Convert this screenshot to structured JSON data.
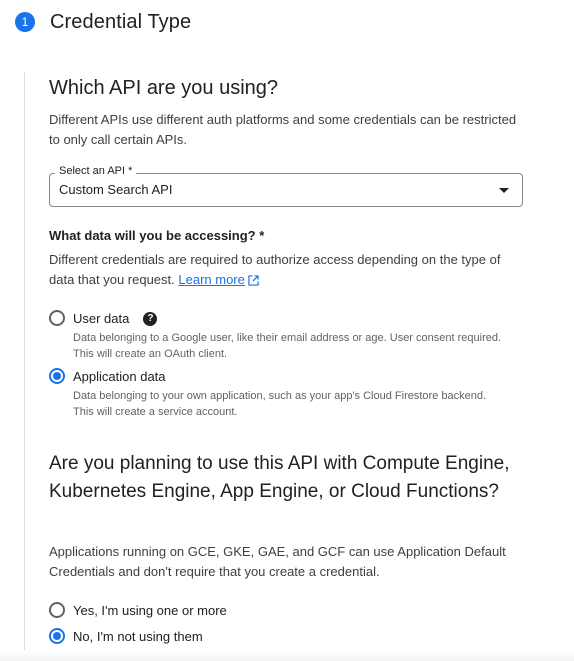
{
  "step": {
    "number": "1",
    "title": "Credential Type"
  },
  "api_question": {
    "title": "Which API are you using?",
    "description": "Different APIs use different auth platforms and some credentials can be restricted to only call certain APIs.",
    "select": {
      "label": "Select an API *",
      "value": "Custom Search API"
    }
  },
  "data_question": {
    "title": "What data will you be accessing? *",
    "description": "Different credentials are required to authorize access depending on the type of data that you request.",
    "learn_more": "Learn more",
    "options": [
      {
        "label": "User data",
        "help": "Data belonging to a Google user, like their email address or age. User consent required. This will create an OAuth client.",
        "selected": false
      },
      {
        "label": "Application data",
        "help": "Data belonging to your own application, such as your app's Cloud Firestore backend. This will create a service account.",
        "selected": true
      }
    ]
  },
  "compute_question": {
    "title": "Are you planning to use this API with Compute Engine, Kubernetes Engine, App Engine, or Cloud Functions?",
    "description": "Applications running on GCE, GKE, GAE, and GCF can use Application Default Credentials and don't require that you create a credential.",
    "options": [
      {
        "label": "Yes, I'm using one or more",
        "selected": false
      },
      {
        "label": "No, I'm not using them",
        "selected": true
      }
    ]
  },
  "colors": {
    "accent": "#1a73e8",
    "text": "#202124",
    "secondary_text": "#5f6368"
  },
  "icons": [
    "help-icon",
    "external-link-icon",
    "dropdown-arrow-icon"
  ]
}
